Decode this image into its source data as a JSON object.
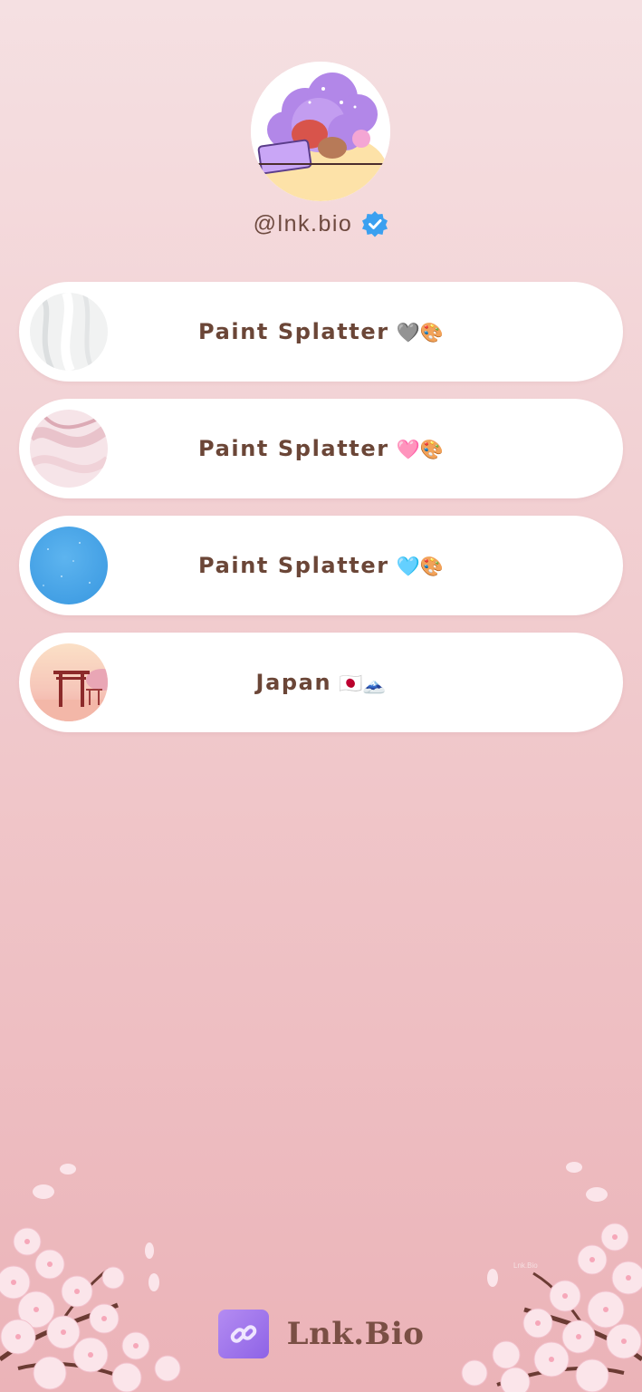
{
  "profile": {
    "handle": "@lnk.bio",
    "verified": true
  },
  "links": [
    {
      "title": "Paint Splatter",
      "emoji": "🩶🎨",
      "thumbnail": "white-marble-paint"
    },
    {
      "title": "Paint Splatter",
      "emoji": "🩷🎨",
      "thumbnail": "pink-marble-paint"
    },
    {
      "title": "Paint Splatter",
      "emoji": "🩵🎨",
      "thumbnail": "blue-glitter-paint"
    },
    {
      "title": "Japan",
      "emoji": "🇯🇵🗻",
      "thumbnail": "torii-gate-sunset"
    }
  ],
  "footer": {
    "brand": "Lnk.Bio",
    "watermark": "Lnk.Bio"
  },
  "colors": {
    "background_top": "#f5e0e2",
    "background_bottom": "#ebb3b8",
    "text": "#6b4637",
    "card": "#ffffff",
    "verified_badge": "#3aa0f0",
    "logo": "#a37bee"
  }
}
